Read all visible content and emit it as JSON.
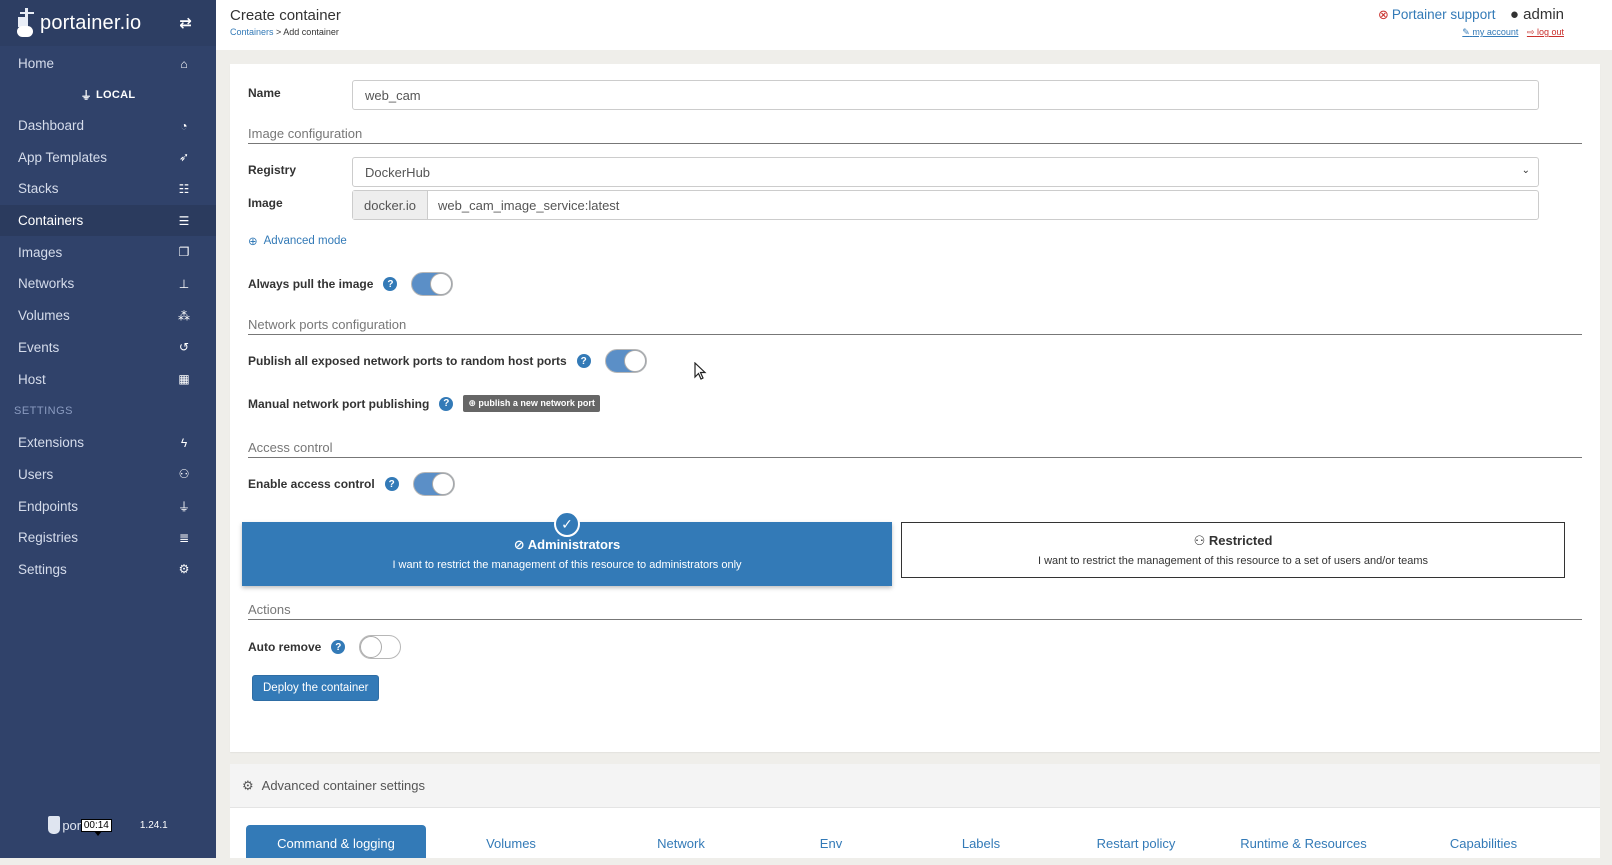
{
  "app": {
    "brand": "portainer.io",
    "version": "1.24.1",
    "timer": "00:14",
    "footer_brand": "portai"
  },
  "sidebar": {
    "home": {
      "label": "Home",
      "icon": "home-icon"
    },
    "endpoint": "LOCAL",
    "items": [
      {
        "label": "Dashboard",
        "icon": "tachometer-icon"
      },
      {
        "label": "App Templates",
        "icon": "rocket-icon"
      },
      {
        "label": "Stacks",
        "icon": "th-list-icon"
      },
      {
        "label": "Containers",
        "icon": "server-icon",
        "active": true
      },
      {
        "label": "Images",
        "icon": "clone-icon"
      },
      {
        "label": "Networks",
        "icon": "sitemap-icon"
      },
      {
        "label": "Volumes",
        "icon": "cubes-icon"
      },
      {
        "label": "Events",
        "icon": "history-icon"
      },
      {
        "label": "Host",
        "icon": "th-icon"
      }
    ],
    "settings_section": "SETTINGS",
    "settings_items": [
      {
        "label": "Extensions",
        "icon": "bolt-icon"
      },
      {
        "label": "Users",
        "icon": "users-icon"
      },
      {
        "label": "Endpoints",
        "icon": "plug-icon"
      },
      {
        "label": "Registries",
        "icon": "database-icon"
      },
      {
        "label": "Settings",
        "icon": "cogs-icon"
      }
    ]
  },
  "header": {
    "title": "Create container",
    "breadcrumb_link": "Containers",
    "breadcrumb_sep": " > ",
    "breadcrumb_current": "Add container",
    "support": "Portainer support",
    "user": "admin",
    "my_account": "my account",
    "log_out": "log out"
  },
  "form": {
    "name_label": "Name",
    "name_value": "web_cam",
    "image_config_title": "Image configuration",
    "registry_label": "Registry",
    "registry_value": "DockerHub",
    "image_label": "Image",
    "image_prefix": "docker.io",
    "image_value": "web_cam_image_service:latest",
    "advanced_mode": "Advanced mode",
    "always_pull_label": "Always pull the image",
    "always_pull": true,
    "network_ports_title": "Network ports configuration",
    "publish_all_label": "Publish all exposed network ports to random host ports",
    "publish_all": true,
    "manual_publish_label": "Manual network port publishing",
    "publish_new_port": "publish a new network port",
    "access_control_title": "Access control",
    "enable_access_label": "Enable access control",
    "enable_access": true,
    "access_options": [
      {
        "title": "Administrators",
        "desc": "I want to restrict the management of this resource to administrators only",
        "selected": true
      },
      {
        "title": "Restricted",
        "desc": "I want to restrict the management of this resource to a set of users and/or teams",
        "selected": false
      }
    ],
    "actions_title": "Actions",
    "auto_remove_label": "Auto remove",
    "auto_remove": false,
    "deploy_button": "Deploy the container"
  },
  "advanced": {
    "title": "Advanced container settings",
    "tabs": [
      {
        "label": "Command & logging",
        "active": true
      },
      {
        "label": "Volumes"
      },
      {
        "label": "Network"
      },
      {
        "label": "Env"
      },
      {
        "label": "Labels"
      },
      {
        "label": "Restart policy"
      },
      {
        "label": "Runtime & Resources"
      },
      {
        "label": "Capabilities"
      }
    ]
  },
  "colors": {
    "sidebar": "#30426a",
    "primary": "#337ab7",
    "danger": "#c9302c"
  }
}
